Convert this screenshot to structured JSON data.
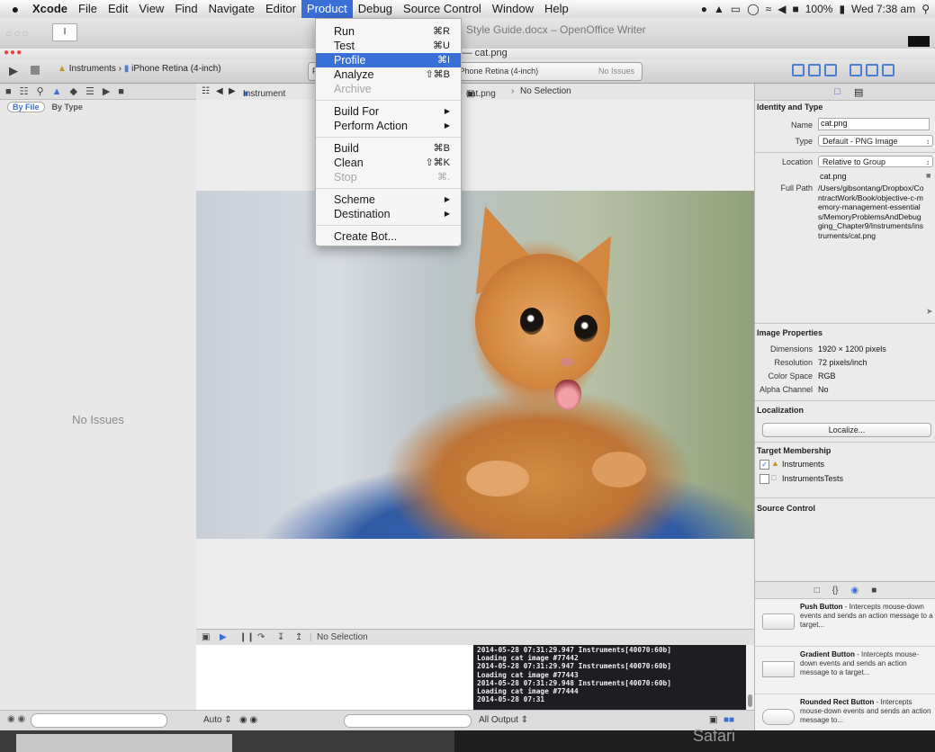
{
  "menubar": {
    "apple": "",
    "items": [
      "Xcode",
      "File",
      "Edit",
      "View",
      "Find",
      "Navigate",
      "Editor",
      "Product",
      "Debug",
      "Source Control",
      "Window",
      "Help"
    ],
    "active": "Product",
    "battery": "100%",
    "clock": "Wed 7:38 am"
  },
  "bgwindow": {
    "doc_title": "Style Guide.docx – OpenOffice Writer",
    "box_text": "I"
  },
  "window": {
    "title": "ts — cat.png",
    "scheme_target": "Instruments",
    "scheme_device": "iPhone Retina (4-inch)",
    "activity_left": "Fi",
    "activity_text": "ts.app on iPhone Retina (4-inch)",
    "activity_status": "No Issues"
  },
  "navigator": {
    "filter_selected": "By File",
    "filter_other": "By Type",
    "empty_text": "No Issues"
  },
  "jumpbar": {
    "left": "Instrument",
    "file": "cat.png",
    "selection": "No Selection"
  },
  "debug": {
    "selection": "No Selection",
    "auto": "Auto ⇕",
    "output": "All Output ⇕",
    "console_lines": [
      "2014-05-28 07:31:29.947 Instruments[40070:60b]",
      "Loading cat image #77442",
      "2014-05-28 07:31:29.947 Instruments[40070:60b]",
      "Loading cat image #77443",
      "2014-05-28 07:31:29.948 Instruments[40070:60b]",
      "Loading cat image #77444",
      "2014-05-28 07:31"
    ]
  },
  "inspector": {
    "identity_title": "Identity and Type",
    "name_label": "Name",
    "name_value": "cat.png",
    "type_label": "Type",
    "type_value": "Default - PNG Image",
    "location_label": "Location",
    "location_value": "Relative to Group",
    "location_file": "cat.png",
    "fullpath_label": "Full Path",
    "fullpath_value": "/Users/gibsontang/Dropbox/ContractWork/Book/objective-c-memory-management-essentials/MemoryProblemsAndDebugging_Chapter9/Instruments/instruments/cat.png",
    "image_props_title": "Image Properties",
    "dimensions_label": "Dimensions",
    "dimensions_value": "1920 × 1200 pixels",
    "resolution_label": "Resolution",
    "resolution_value": "72 pixels/inch",
    "colorspace_label": "Color Space",
    "colorspace_value": "RGB",
    "alpha_label": "Alpha Channel",
    "alpha_value": "No",
    "localization_title": "Localization",
    "localize_button": "Localize...",
    "target_title": "Target Membership",
    "target_1": "Instruments",
    "target_2": "InstrumentsTests",
    "source_control_title": "Source Control"
  },
  "library": {
    "items": [
      {
        "name": "Push Button",
        "desc": " - Intercepts mouse-down events and sends an action message to a target..."
      },
      {
        "name": "Gradient Button",
        "desc": " - Intercepts mouse-down events and sends an action message to a target..."
      },
      {
        "name": "Rounded Rect Button",
        "desc": " - Intercepts mouse-down events and sends an action message to..."
      }
    ]
  },
  "product_menu": {
    "items": [
      {
        "label": "Run",
        "shortcut": "⌘R",
        "enabled": true
      },
      {
        "label": "Test",
        "shortcut": "⌘U",
        "enabled": true
      },
      {
        "label": "Profile",
        "shortcut": "⌘I",
        "enabled": true,
        "highlighted": true
      },
      {
        "label": "Analyze",
        "shortcut": "⇧⌘B",
        "enabled": true
      },
      {
        "label": "Archive",
        "shortcut": "",
        "enabled": false
      },
      {
        "label": "Build For",
        "shortcut": "▶",
        "enabled": true
      },
      {
        "label": "Perform Action",
        "shortcut": "▶",
        "enabled": true
      },
      {
        "label": "Build",
        "shortcut": "⌘B",
        "enabled": true
      },
      {
        "label": "Clean",
        "shortcut": "⇧⌘K",
        "enabled": true
      },
      {
        "label": "Stop",
        "shortcut": "⌘.",
        "enabled": false
      },
      {
        "label": "Scheme",
        "shortcut": "▶",
        "enabled": true
      },
      {
        "label": "Destination",
        "shortcut": "▶",
        "enabled": true
      },
      {
        "label": "Create Bot...",
        "shortcut": "",
        "enabled": true
      }
    ]
  },
  "bottom": {
    "safari": "Safari"
  }
}
